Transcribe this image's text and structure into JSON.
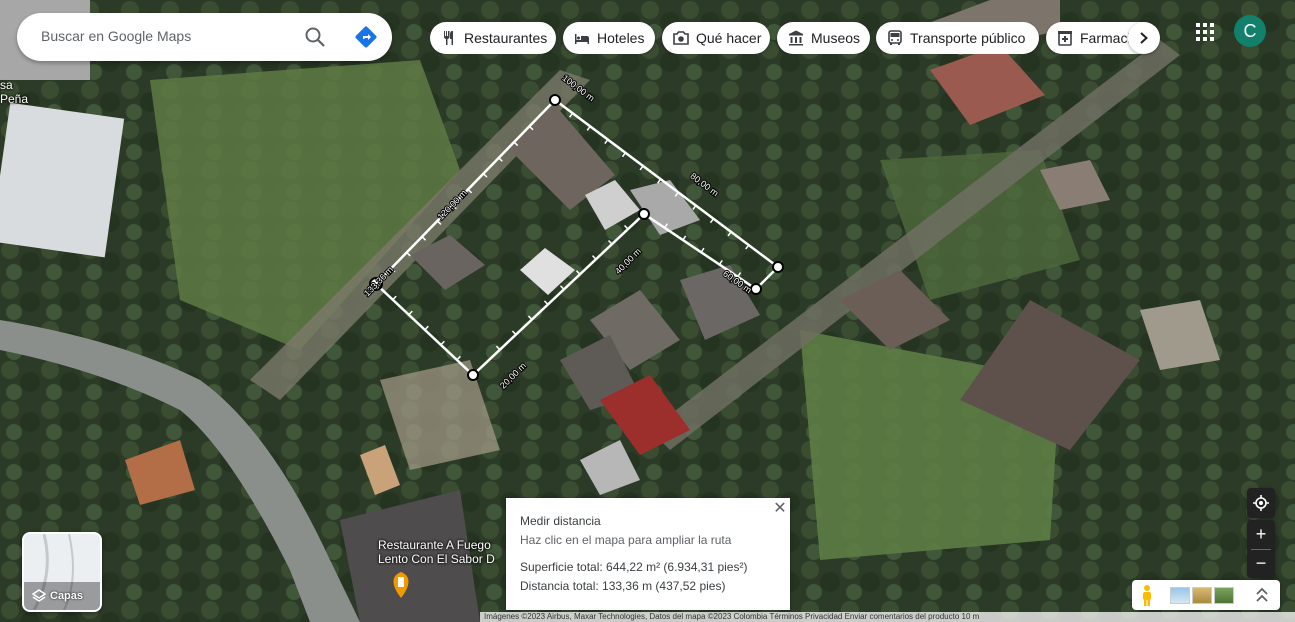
{
  "search": {
    "placeholder": "Buscar en Google Maps"
  },
  "icons": {
    "search": "search-icon",
    "directions": "directions-icon",
    "apps": "apps-grid-icon",
    "layers": "layers-icon",
    "locate": "my-location-icon",
    "pegman": "pegman-icon"
  },
  "chips": [
    {
      "label": "Restaurantes",
      "icon": "fork-knife-icon"
    },
    {
      "label": "Hoteles",
      "icon": "bed-icon"
    },
    {
      "label": "Qué hacer",
      "icon": "camera-icon"
    },
    {
      "label": "Museos",
      "icon": "museum-icon"
    },
    {
      "label": "Transporte público",
      "icon": "bus-icon"
    },
    {
      "label": "Farmacias",
      "icon": "pharmacy-icon"
    }
  ],
  "account": {
    "initial": "C",
    "color": "#12806b"
  },
  "map_labels": {
    "corner": "sa\nPeña",
    "restaurant": "Restaurante A Fuego\nLento Con El Sabor D"
  },
  "measurement": {
    "segment_labels": [
      "100,00 m",
      "80,00 m",
      "60,00 m",
      "40,00 m",
      "20,00 m",
      "120,00 m",
      "133,36 m"
    ],
    "colors": {
      "line": "#ffffff",
      "vertex_fill": "#ffffff",
      "vertex_stroke": "#000000"
    }
  },
  "measure_panel": {
    "title": "Medir distancia",
    "hint": "Haz clic en el mapa para ampliar la ruta",
    "area": "Superficie total: 644,22 m² (6.934,31 pies²)",
    "distance": "Distancia total: 133,36 m (437,52 pies)"
  },
  "layers_button": {
    "label": "Capas"
  },
  "zoom": {
    "in": "+",
    "out": "−"
  },
  "credit": "Imágenes ©2023 Airbus, Maxar Technologies, Datos del mapa ©2023  Colombia  Términos  Privacidad  Enviar comentarios del producto  10 m"
}
